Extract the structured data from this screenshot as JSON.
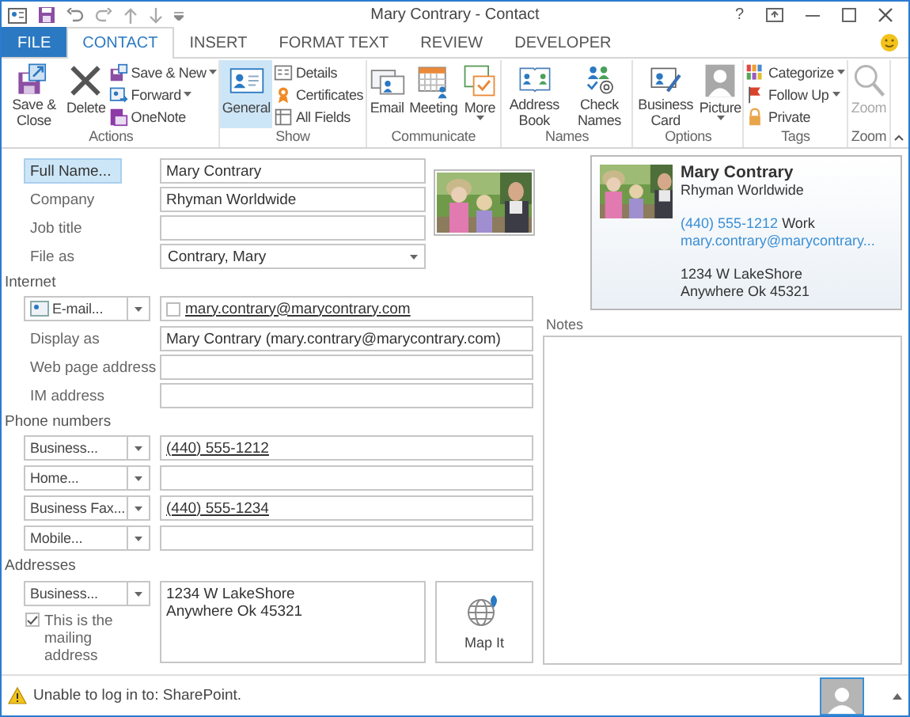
{
  "window": {
    "title": "Mary Contrary - Contact",
    "help_label": "?"
  },
  "tabs": [
    {
      "label": "FILE",
      "kind": "file",
      "selected": false
    },
    {
      "label": "CONTACT",
      "kind": "tab",
      "selected": true
    },
    {
      "label": "INSERT",
      "kind": "tab",
      "selected": false
    },
    {
      "label": "FORMAT TEXT",
      "kind": "tab",
      "selected": false
    },
    {
      "label": "REVIEW",
      "kind": "tab",
      "selected": false
    },
    {
      "label": "DEVELOPER",
      "kind": "tab",
      "selected": false
    }
  ],
  "ribbon": {
    "groups": [
      {
        "label": "Actions",
        "items": [
          {
            "label": "Save & Close",
            "kind": "large",
            "dropdown": false
          },
          {
            "label": "Delete",
            "kind": "large",
            "dropdown": false
          },
          {
            "label": "Save & New",
            "kind": "small",
            "dropdown": true
          },
          {
            "label": "Forward",
            "kind": "small",
            "dropdown": true
          },
          {
            "label": "OneNote",
            "kind": "small",
            "dropdown": false
          }
        ]
      },
      {
        "label": "Show",
        "items": [
          {
            "label": "General",
            "kind": "large",
            "dropdown": false,
            "selected": true
          },
          {
            "label": "Details",
            "kind": "small",
            "dropdown": false,
            "selected": false
          },
          {
            "label": "Certificates",
            "kind": "small",
            "dropdown": false,
            "selected": false
          },
          {
            "label": "All Fields",
            "kind": "small",
            "dropdown": false,
            "selected": false
          }
        ]
      },
      {
        "label": "Communicate",
        "items": [
          {
            "label": "Email",
            "kind": "large",
            "dropdown": false
          },
          {
            "label": "Meeting",
            "kind": "large",
            "dropdown": false
          },
          {
            "label": "More",
            "kind": "large",
            "dropdown": true
          }
        ]
      },
      {
        "label": "Names",
        "items": [
          {
            "label": "Address Book",
            "kind": "large",
            "dropdown": false
          },
          {
            "label": "Check Names",
            "kind": "large",
            "dropdown": false
          }
        ]
      },
      {
        "label": "Options",
        "items": [
          {
            "label": "Business Card",
            "kind": "large",
            "dropdown": false
          },
          {
            "label": "Picture",
            "kind": "large",
            "dropdown": true
          }
        ]
      },
      {
        "label": "Tags",
        "items": [
          {
            "label": "Categorize",
            "kind": "small",
            "dropdown": true
          },
          {
            "label": "Follow Up",
            "kind": "small",
            "dropdown": true
          },
          {
            "label": "Private",
            "kind": "small",
            "dropdown": false
          }
        ]
      },
      {
        "label": "Zoom",
        "items": [
          {
            "label": "Zoom",
            "kind": "large",
            "dropdown": false,
            "disabled": true
          }
        ]
      }
    ]
  },
  "contact": {
    "identity": [
      {
        "kind": "button",
        "label": "Full Name...",
        "highlighted": true,
        "value": "Mary Contrary"
      },
      {
        "kind": "label",
        "label": "Company",
        "value": "Rhyman Worldwide"
      },
      {
        "kind": "label",
        "label": "Job title"
      },
      {
        "kind": "dropdown",
        "label": "File as",
        "value": "Contrary, Mary"
      }
    ],
    "sections": [
      {
        "heading": "Internet",
        "rows": [
          {
            "kind": "selector",
            "label": "E-mail...",
            "value": "mary.contrary@marycontrary.com",
            "link": true,
            "checked": false
          },
          {
            "kind": "label",
            "label": "Display as",
            "value": "Mary Contrary (mary.contrary@marycontrary.com)"
          },
          {
            "kind": "label",
            "label": "Web page address"
          },
          {
            "kind": "label",
            "label": "IM address"
          }
        ]
      },
      {
        "heading": "Phone numbers",
        "rows": [
          {
            "kind": "selector",
            "label": "Business...",
            "value": "(440) 555-1212",
            "link": true
          },
          {
            "kind": "selector",
            "label": "Home..."
          },
          {
            "kind": "selector",
            "label": "Business Fax...",
            "value": "(440) 555-1234",
            "link": true
          },
          {
            "kind": "selector",
            "label": "Mobile..."
          }
        ]
      }
    ],
    "address": {
      "heading": "Addresses",
      "selector": "Business...",
      "lines": [
        "1234 W LakeShore",
        "Anywhere Ok 45321"
      ],
      "mailing": {
        "label": "This is the mailing address",
        "checked": true
      },
      "map_button": "Map It"
    }
  },
  "business_card": {
    "name": "Mary Contrary",
    "company": "Rhyman Worldwide",
    "phone": "(440) 555-1212",
    "phone_type": "Work",
    "email": "mary.contrary@marycontrary...",
    "address": [
      "1234 W LakeShore",
      "Anywhere Ok 45321"
    ]
  },
  "notes": {
    "label": "Notes"
  },
  "status_bar": {
    "message": "Unable to log in to: SharePoint."
  }
}
